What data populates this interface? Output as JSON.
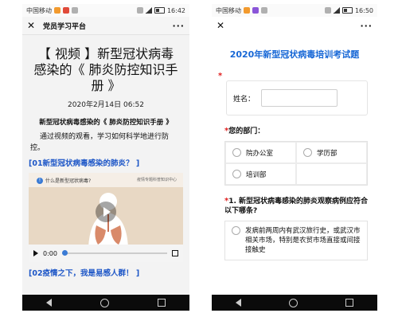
{
  "left": {
    "status": {
      "carrier": "中国移动",
      "time": "16:42"
    },
    "nav": {
      "close": "✕",
      "title": "党员学习平台",
      "more": "···"
    },
    "article": {
      "title": "【 视频 】新型冠状病毒感染的《 肺炎防控知识手册 》",
      "date": "2020年2月14日 06:52",
      "subheading": "新型冠状病毒感染的《 肺炎防控知识手册 》",
      "intro": "通过视频的观看，学习如何科学地进行防控。",
      "section1": "[01新型冠状病毒感染的肺炎？ ]",
      "section2": "[02疫情之下，我是易感人群！ ]"
    },
    "video": {
      "question": "什么是新型冠状病毒?",
      "brand": "疫情专题科普知识中心",
      "time": "0:00"
    }
  },
  "right": {
    "status": {
      "carrier": "中国移动",
      "time": "16:50"
    },
    "nav": {
      "close": "✕",
      "more": "···"
    },
    "survey": {
      "title": "2020年新型冠状病毒培训考试题",
      "required_mark": "*",
      "name_label": "姓名：",
      "dept_label": "您的部门：",
      "dept_options": [
        "院办公室",
        "学历部",
        "培训部"
      ],
      "q1": "1. 新型冠状病毒感染的肺炎观察病例应符合以下哪条?",
      "q1_option1": "发病前两周内有武汉旅行史，或武汉市相关市场，特别是农贸市场直接或间接接触史"
    }
  },
  "colors": {
    "accent_blue": "#1767d6",
    "required_red": "#e02020",
    "section_blue": "#1d56c7"
  }
}
